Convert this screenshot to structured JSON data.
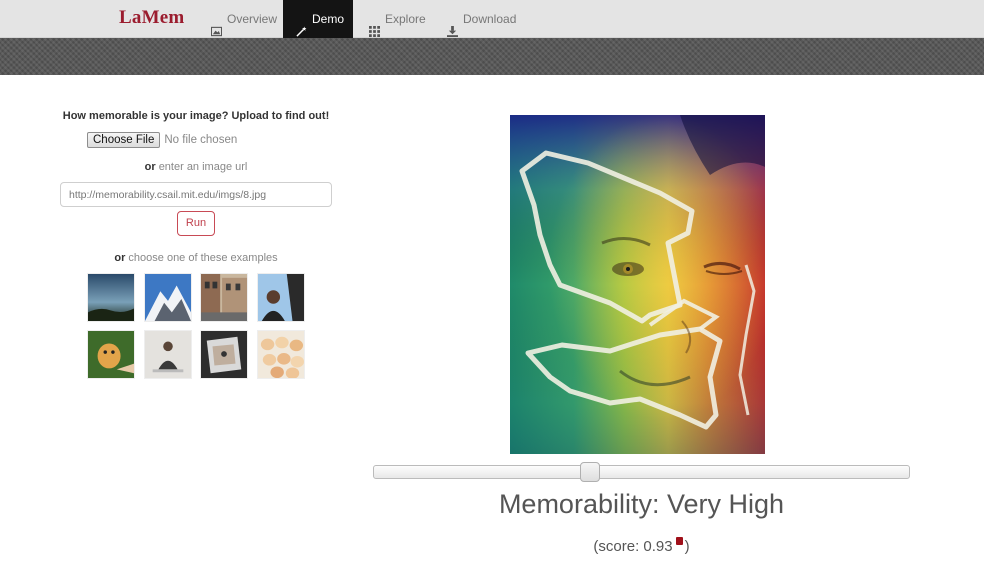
{
  "navbar": {
    "brand": "LaMem",
    "items": [
      {
        "label": "Overview",
        "icon": "image-icon",
        "active": false
      },
      {
        "label": "Demo",
        "icon": "magic-wand-icon",
        "active": true
      },
      {
        "label": "Explore",
        "icon": "grid-icon",
        "active": false
      },
      {
        "label": "Download",
        "icon": "download-icon",
        "active": false
      }
    ]
  },
  "upload": {
    "title": "How memorable is your image? Upload to find out!",
    "choose_file_label": "Choose File",
    "no_file_text": "No file chosen",
    "or_label": "or",
    "url_prompt": "enter an image url",
    "url_value": "http://memorability.csail.mit.edu/imgs/8.jpg",
    "run_label": "Run",
    "examples_prompt": "choose one of these examples",
    "example_count": 8
  },
  "result": {
    "memorability_label": "Memorability:",
    "memorability_value": "Very High",
    "score_open": "(score:",
    "score_value": "0.93",
    "score_close": ")",
    "slider_value": 0.4
  },
  "colors": {
    "brand": "#9b1c2e",
    "run_border": "#c84a55",
    "navbar_active": "#141414"
  }
}
